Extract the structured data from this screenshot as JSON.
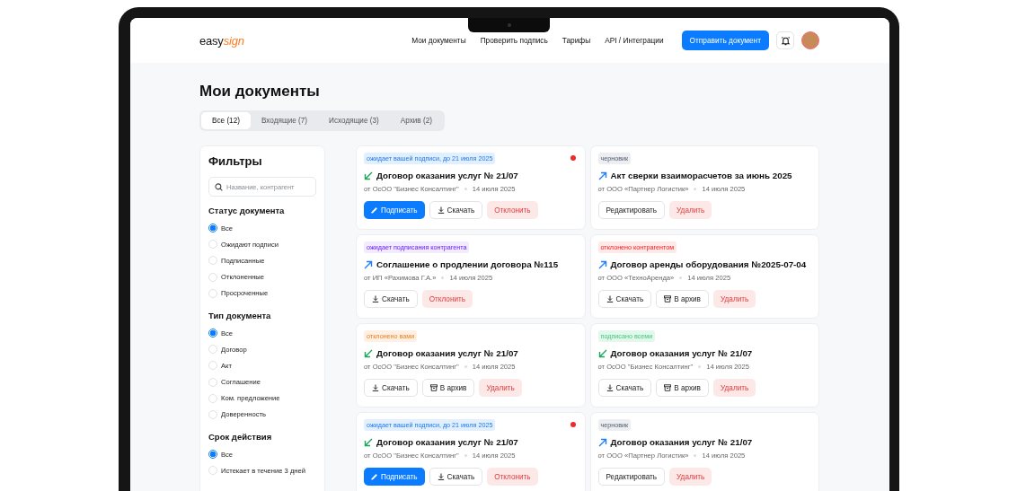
{
  "header": {
    "logo": {
      "first": "easy",
      "second": "sign"
    },
    "nav": [
      "Мои документы",
      "Проверить подпись",
      "Тарифы",
      "API / Интеграции"
    ],
    "primary_button": "Отправить документ"
  },
  "page_title": "Мои документы",
  "tabs": [
    {
      "label": "Все (12)",
      "selected": true
    },
    {
      "label": "Входящие (7)",
      "selected": false
    },
    {
      "label": "Исходящие (3)",
      "selected": false
    },
    {
      "label": "Архив (2)",
      "selected": false
    }
  ],
  "filters": {
    "title": "Фильтры",
    "search": {
      "placeholder": "Название, контрагент"
    },
    "groups": [
      {
        "title": "Статус документа",
        "options": [
          {
            "label": "Все",
            "selected": true
          },
          {
            "label": "Ожидают подписи",
            "selected": false
          },
          {
            "label": "Подписанные",
            "selected": false
          },
          {
            "label": "Отклоненные",
            "selected": false
          },
          {
            "label": "Просроченные",
            "selected": false
          }
        ]
      },
      {
        "title": "Тип документа",
        "options": [
          {
            "label": "Все",
            "selected": true
          },
          {
            "label": "Договор",
            "selected": false
          },
          {
            "label": "Акт",
            "selected": false
          },
          {
            "label": "Соглашение",
            "selected": false
          },
          {
            "label": "Ком. предложение",
            "selected": false
          },
          {
            "label": "Доверенность",
            "selected": false
          }
        ]
      },
      {
        "title": "Срок действия",
        "options": [
          {
            "label": "Все",
            "selected": true
          },
          {
            "label": "Истекает в течение 3 дней",
            "selected": false
          }
        ]
      }
    ]
  },
  "documents": [
    {
      "status": "ожидает вашей подписи, до 21 июля 2025",
      "color": "#e2efff",
      "unread": true,
      "incoming": true,
      "title": "Договор оказания услуг № 21/07",
      "from": "от ОсОО \"Бизнес Консалтинг\"",
      "date": "14 июля 2025",
      "actions": [
        {
          "kind": "sign",
          "label": "Подписать"
        },
        {
          "kind": "download",
          "label": "Скачать"
        },
        {
          "kind": "reject",
          "label": "Отклонить"
        }
      ]
    },
    {
      "status": "черновик",
      "color": "#eceef1",
      "unread": false,
      "incoming": false,
      "title": "Акт сверки взаиморасчетов за июнь 2025",
      "from": "от ООО «Партнер Логистик»",
      "date": "14 июля 2025",
      "actions": [
        {
          "kind": "edit",
          "label": "Редактировать"
        },
        {
          "kind": "delete",
          "label": "Удалить"
        }
      ]
    },
    {
      "status": "ожидает подписания контрагента",
      "color": "#f2ebff",
      "unread": false,
      "incoming": false,
      "title": "Соглашение о продлении договора №115",
      "from": "от ИП «Рахимова Г.А.»",
      "date": "14 июля 2025",
      "actions": [
        {
          "kind": "download",
          "label": "Скачать"
        },
        {
          "kind": "reject",
          "label": "Отклонить"
        }
      ]
    },
    {
      "status": "отклонено контрагентом",
      "color": "#ffe8e8",
      "unread": false,
      "incoming": false,
      "title": "Договор аренды оборудования №2025-07-04",
      "from": "от ООО «ТехноАренда»",
      "date": "14 июля 2025",
      "actions": [
        {
          "kind": "download",
          "label": "Скачать"
        },
        {
          "kind": "archive",
          "label": "В архив"
        },
        {
          "kind": "delete",
          "label": "Удалить"
        }
      ]
    },
    {
      "status": "отклонено вами",
      "color": "#fff0e3",
      "unread": false,
      "incoming": true,
      "title": "Договор оказания услуг № 21/07",
      "from": "от ОсОО \"Бизнес Консалтинг\"",
      "date": "14 июля 2025",
      "actions": [
        {
          "kind": "download",
          "label": "Скачать"
        },
        {
          "kind": "archive",
          "label": "В архив"
        },
        {
          "kind": "delete",
          "label": "Удалить"
        }
      ]
    },
    {
      "status": "подписано всеми",
      "color": "#e3f7ec",
      "unread": false,
      "incoming": true,
      "title": "Договор оказания услуг № 21/07",
      "from": "от ОсОО \"Бизнес Консалтинг\"",
      "date": "14 июля 2025",
      "actions": [
        {
          "kind": "download",
          "label": "Скачать"
        },
        {
          "kind": "archive",
          "label": "В архив"
        },
        {
          "kind": "delete",
          "label": "Удалить"
        }
      ]
    },
    {
      "status": "ожидает вашей подписи, до 21 июля 2025",
      "color": "#e2efff",
      "unread": true,
      "incoming": true,
      "title": "Договор оказания услуг № 21/07",
      "from": "от ОсОО \"Бизнес Консалтинг\"",
      "date": "14 июля 2025",
      "actions": [
        {
          "kind": "sign",
          "label": "Подписать"
        },
        {
          "kind": "download",
          "label": "Скачать"
        },
        {
          "kind": "reject",
          "label": "Отклонить"
        }
      ]
    },
    {
      "status": "черновик",
      "color": "#eceef1",
      "unread": false,
      "incoming": false,
      "title": "Договор оказания услуг № 21/07",
      "from": "от ООО «Партнер Логистик»",
      "date": "14 июля 2025",
      "actions": [
        {
          "kind": "edit",
          "label": "Редактировать"
        },
        {
          "kind": "delete",
          "label": "Удалить"
        }
      ]
    }
  ]
}
